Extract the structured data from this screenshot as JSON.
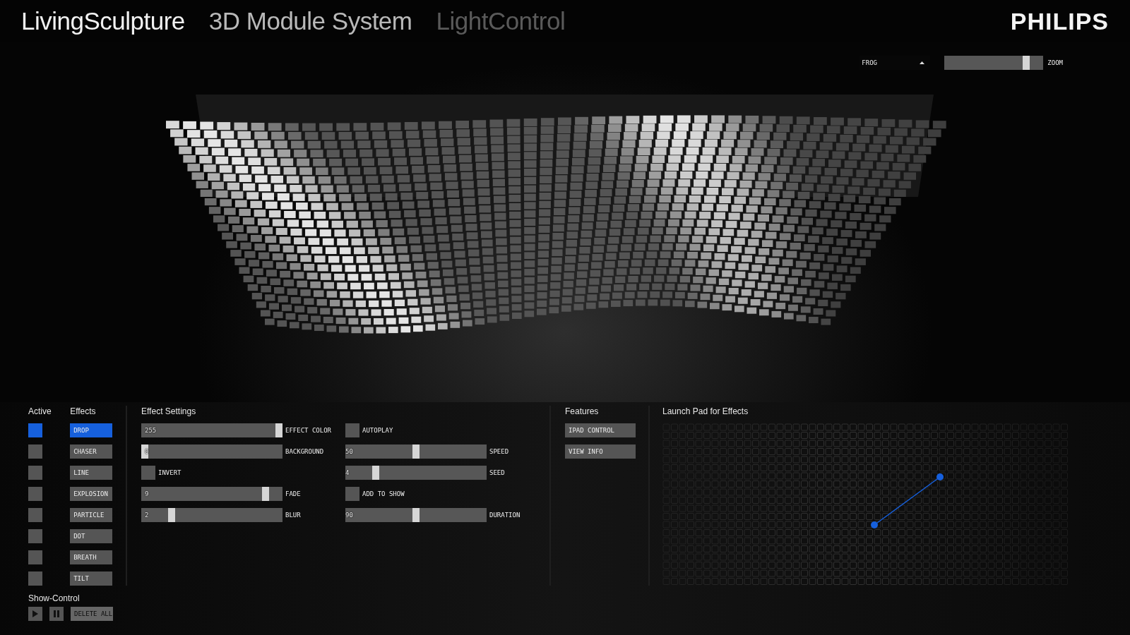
{
  "header": {
    "titles": [
      {
        "text": "LivingSculpture",
        "kind": "primary"
      },
      {
        "text": "3D Module System",
        "kind": "secondary"
      },
      {
        "text": "LightControl",
        "kind": "muted"
      }
    ],
    "brand": "PHILIPS"
  },
  "view": {
    "camera": {
      "value": "FROG"
    },
    "zoom": {
      "label": "ZOOM",
      "level": 0.85
    }
  },
  "active": {
    "heading": "Active"
  },
  "effects": {
    "heading": "Effects",
    "items": [
      {
        "label": "DROP",
        "selected": true,
        "active": true
      },
      {
        "label": "CHASER",
        "selected": false,
        "active": false
      },
      {
        "label": "LINE",
        "selected": false,
        "active": false
      },
      {
        "label": "EXPLOSION",
        "selected": false,
        "active": false
      },
      {
        "label": "PARTICLE",
        "selected": false,
        "active": false
      },
      {
        "label": "DOT",
        "selected": false,
        "active": false
      },
      {
        "label": "BREATH",
        "selected": false,
        "active": false
      },
      {
        "label": "TILT",
        "selected": false,
        "active": false
      }
    ]
  },
  "effect_settings": {
    "heading": "Effect Settings",
    "columns": [
      [
        {
          "kind": "slider",
          "value": "255",
          "label": "EFFECT COLOR",
          "level": 1
        },
        {
          "kind": "slider",
          "value": "0",
          "label": "BACKGROUND",
          "level": 0
        },
        {
          "kind": "toggle",
          "label": "INVERT",
          "checked": false
        },
        {
          "kind": "slider",
          "value": "9",
          "label": "FADE",
          "level": 0.9
        },
        {
          "kind": "slider",
          "value": "2",
          "label": "BLUR",
          "level": 0.2
        }
      ],
      [
        {
          "kind": "toggle",
          "label": "AUTOPLAY",
          "checked": false
        },
        {
          "kind": "slider",
          "value": "50",
          "label": "SPEED",
          "level": 0.5
        },
        {
          "kind": "slider",
          "value": "4",
          "label": "SEED",
          "level": 0.2
        },
        {
          "kind": "toggle",
          "label": "ADD TO SHOW",
          "checked": false
        },
        {
          "kind": "slider",
          "value": "90",
          "label": "DURATION",
          "level": 0.5
        }
      ]
    ]
  },
  "features": {
    "heading": "Features",
    "buttons": [
      "IPAD CONTROL",
      "VIEW INFO"
    ]
  },
  "launch_pad": {
    "heading": "Launch Pad for Effects"
  },
  "show_control": {
    "heading": "Show-Control",
    "delete": {
      "label": "DELETE ALL",
      "disabled": true
    }
  }
}
